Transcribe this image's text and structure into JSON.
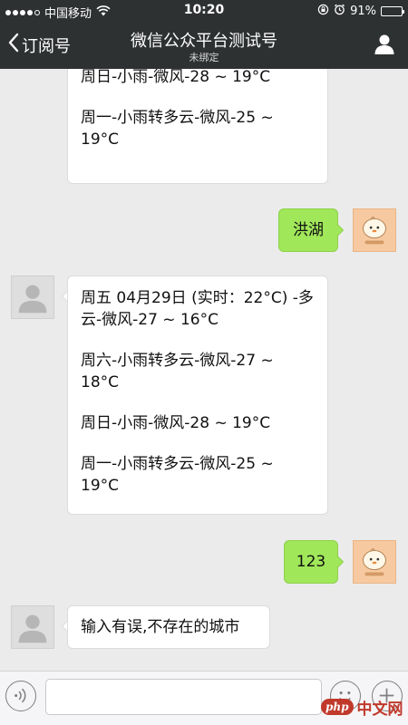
{
  "status_bar": {
    "carrier": "中国移动",
    "time": "10:20",
    "battery_text": "91%",
    "battery_level": 0.91,
    "icons": [
      "signal-dots-icon",
      "wifi-icon",
      "rotation-lock-icon",
      "alarm-icon",
      "battery-icon"
    ]
  },
  "nav": {
    "back_label": "订阅号",
    "title": "微信公众平台测试号",
    "subtitle": "未绑定",
    "back_icon": "chevron-left-icon",
    "profile_icon": "user-icon",
    "background": "#2e3132"
  },
  "messages": [
    {
      "direction": "in",
      "lines": [
        "周日-小雨-微风-28 ~ 19°C",
        "周一-小雨转多云-微风-25 ~ 19°C"
      ]
    },
    {
      "direction": "out",
      "text": "洪湖"
    },
    {
      "direction": "in",
      "lines": [
        "周五 04月29日 (实时：22°C) -多云-微风-27 ~ 16°C",
        "周六-小雨转多云-微风-27 ~ 18°C",
        "周日-小雨-微风-28 ~ 19°C",
        "周一-小雨转多云-微风-25 ~ 19°C"
      ]
    },
    {
      "direction": "out",
      "text": "123"
    },
    {
      "direction": "in",
      "text": "输入有误,不存在的城市"
    }
  ],
  "input_bar": {
    "value": "",
    "placeholder": "",
    "icons": [
      "voice-icon",
      "emoji-icon",
      "plus-icon"
    ]
  },
  "watermark": {
    "badge": "php",
    "text": "中文网"
  },
  "colors": {
    "chat_background": "#ebebeb",
    "incoming_bubble": "#ffffff",
    "outgoing_bubble": "#a0e75a"
  }
}
